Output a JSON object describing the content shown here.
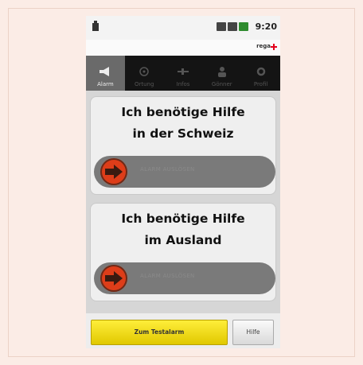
{
  "status_bar": {
    "time": "9:20"
  },
  "brand": {
    "name": "rega"
  },
  "tabs": [
    {
      "label": "Alarm",
      "icon": "megaphone-icon",
      "active": true
    },
    {
      "label": "Ortung",
      "icon": "location-icon",
      "active": false
    },
    {
      "label": "Infos",
      "icon": "plane-icon",
      "active": false
    },
    {
      "label": "Gönner",
      "icon": "person-icon",
      "active": false
    },
    {
      "label": "Profil",
      "icon": "settings-icon",
      "active": false
    }
  ],
  "cards": [
    {
      "title_line1": "Ich benötige Hilfe",
      "title_line2": "in der Schweiz",
      "slider_label": "Alarm auslösen"
    },
    {
      "title_line1": "Ich benötige Hilfe",
      "title_line2": "im Ausland",
      "slider_label": "Alarm auslösen"
    }
  ],
  "buttons": {
    "test_alarm": "Zum Testalarm",
    "help": "Hilfe"
  },
  "colors": {
    "knob": "#dd3d19",
    "test_button": "#ffe21a",
    "brand_red": "#e3001b"
  }
}
